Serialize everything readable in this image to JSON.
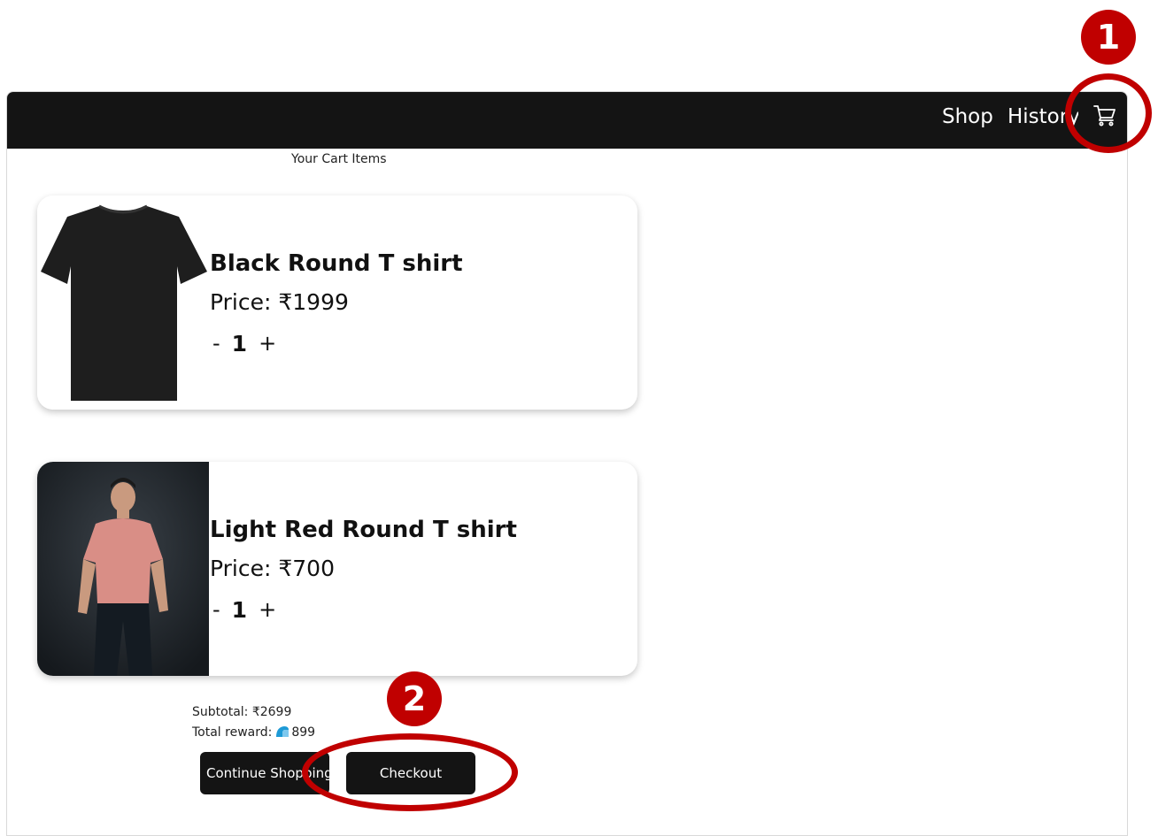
{
  "nav": {
    "shop_label": "Shop",
    "history_label": "History",
    "cart_icon": "cart-icon"
  },
  "cart": {
    "title": "Your Cart Items",
    "items": [
      {
        "name": "Black Round T shirt",
        "price": "Price: ₹1999",
        "quantity": "1",
        "minus": "-",
        "plus": "+",
        "image": "black-tshirt-image"
      },
      {
        "name": "Light Red Round T shirt",
        "price": "Price: ₹700",
        "quantity": "1",
        "minus": "-",
        "plus": "+",
        "image": "model-red-tshirt-image"
      }
    ]
  },
  "summary": {
    "subtotal": "Subtotal: ₹2699",
    "reward_label": "Total reward:",
    "reward_icon": "reward-coin-icon",
    "reward_value": "899"
  },
  "actions": {
    "continue_label": "Continue Shopping",
    "checkout_label": "Checkout"
  },
  "annotations": {
    "badge_1": "1",
    "badge_2": "2",
    "color": "#c00000"
  }
}
